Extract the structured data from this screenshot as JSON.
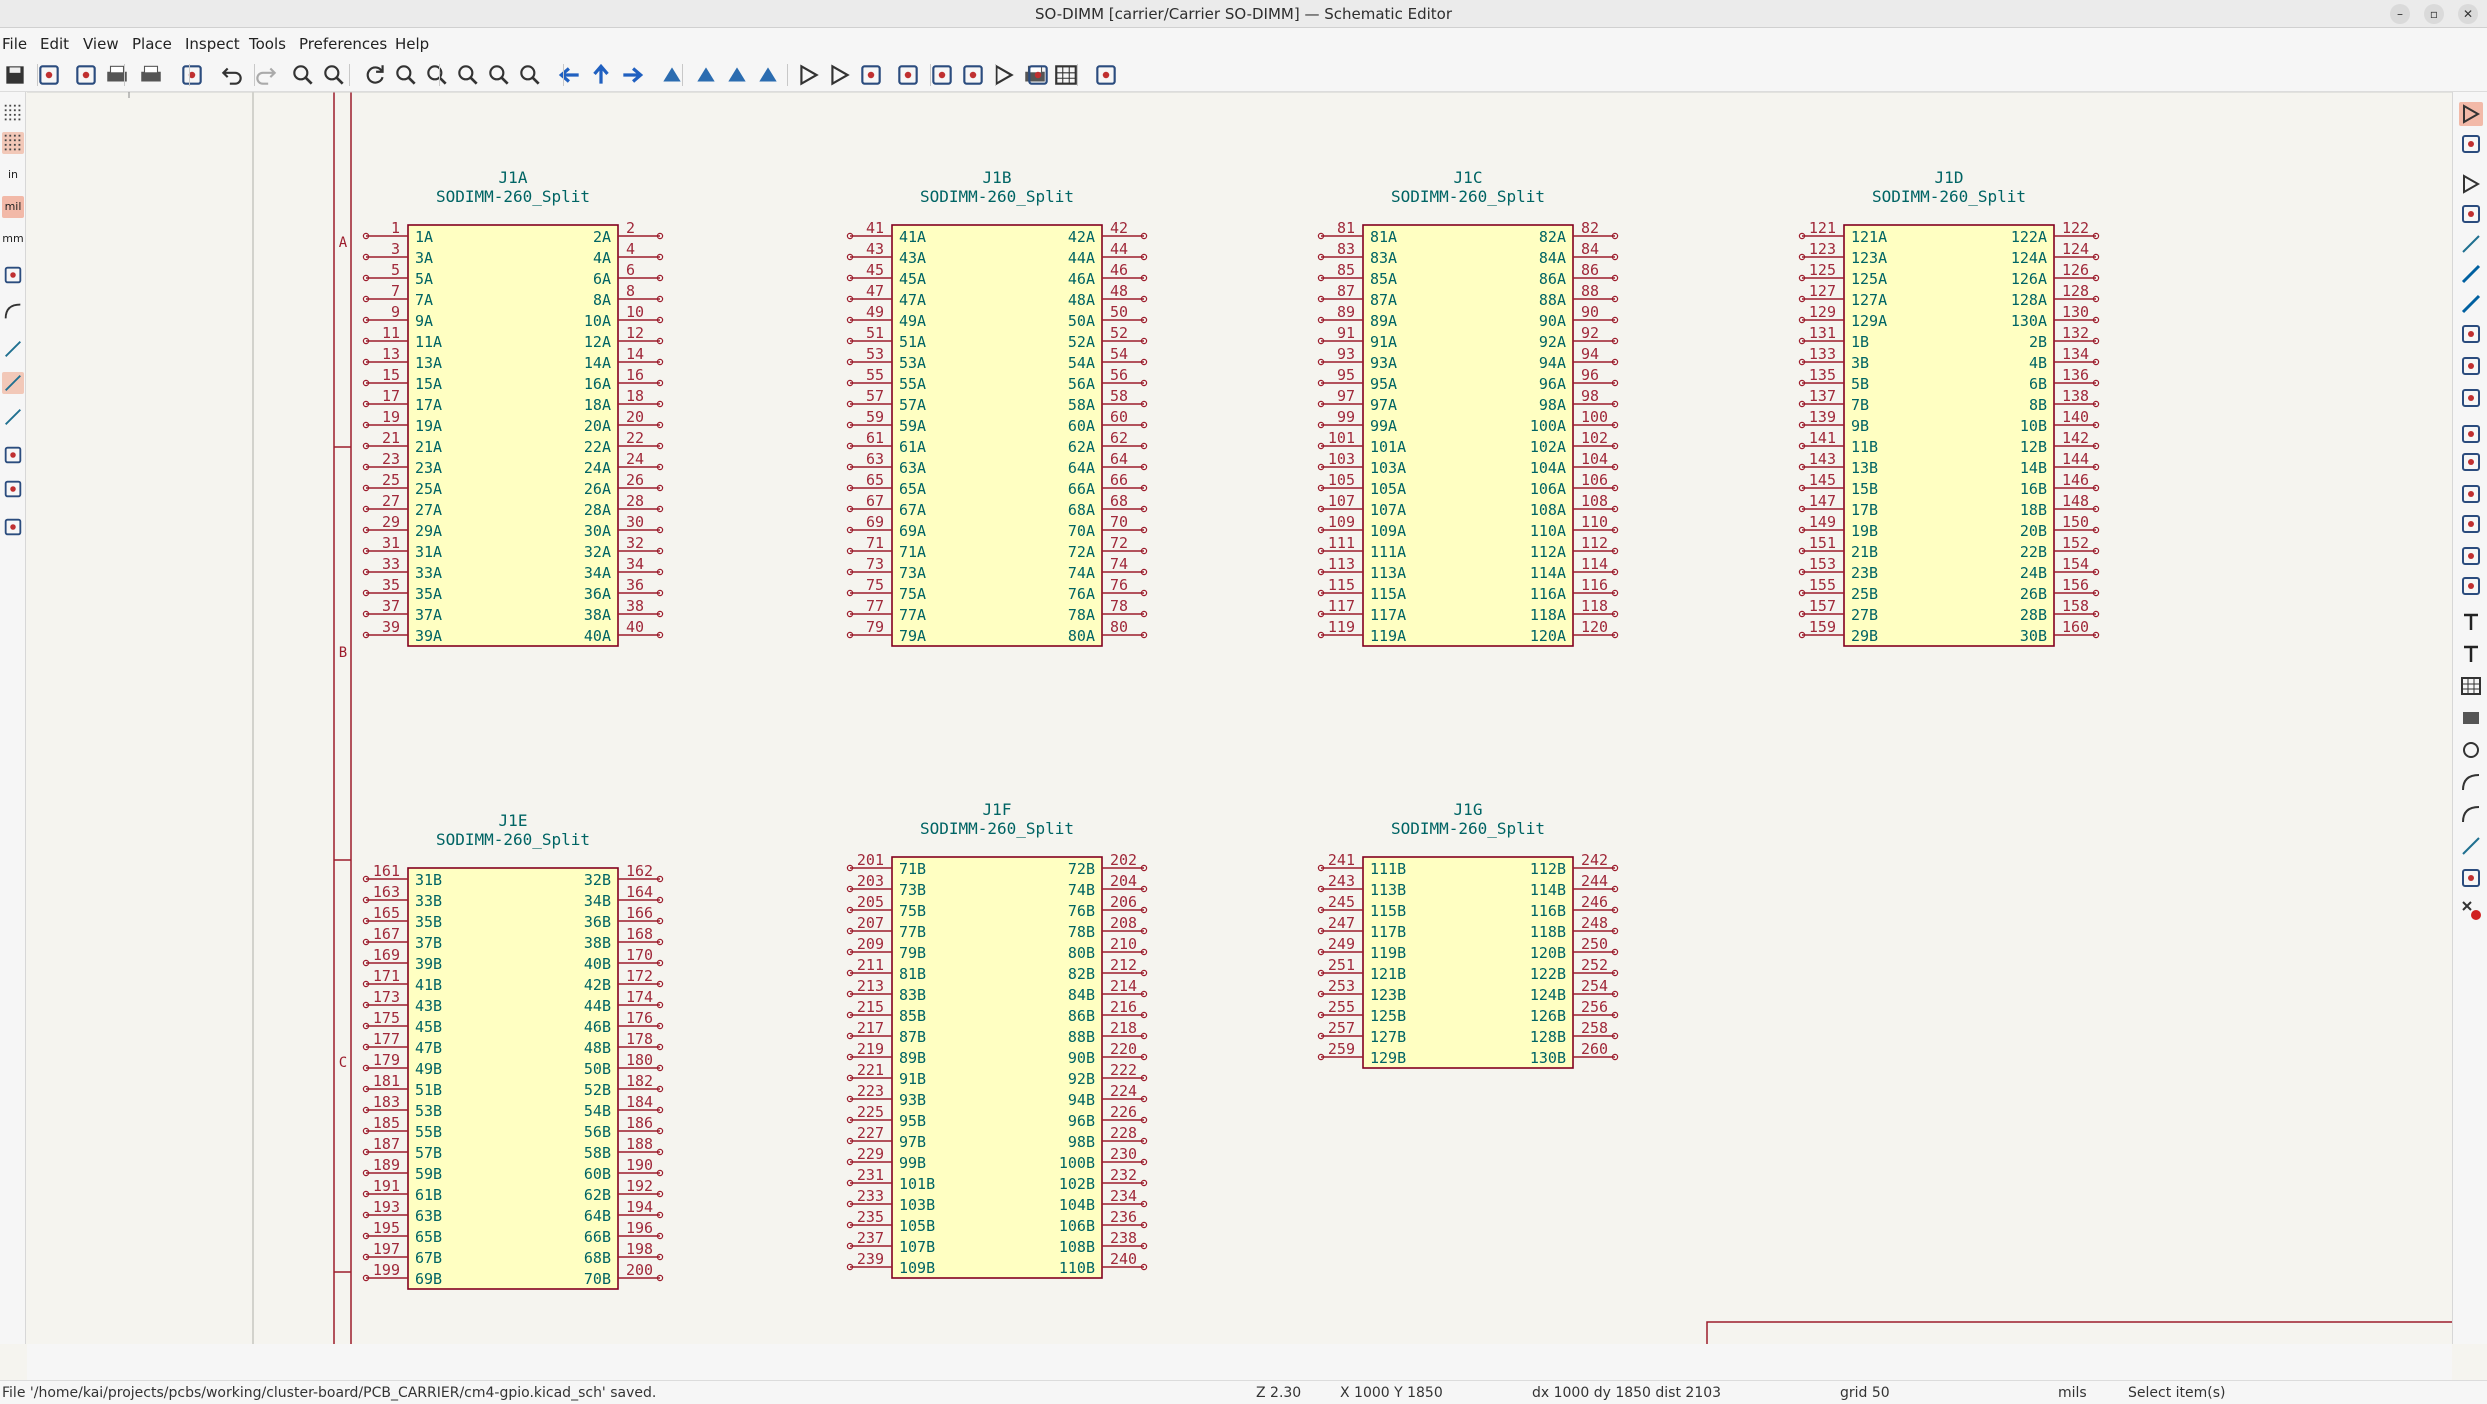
{
  "window": {
    "title": "SO-DIMM [carrier/Carrier SO-DIMM] — Schematic Editor"
  },
  "menu": [
    "File",
    "Edit",
    "View",
    "Place",
    "Inspect",
    "Tools",
    "Preferences",
    "Help"
  ],
  "toolbar_icons": [
    "save-icon",
    "schematic-setup-icon",
    "page-settings-icon",
    "print-icon",
    "plot-icon",
    "paste-icon",
    "undo-icon",
    "redo-icon",
    "find-icon",
    "find-replace-icon",
    "refresh-icon",
    "zoom-in-icon",
    "zoom-out-icon",
    "zoom-fit-icon",
    "zoom-objects-icon",
    "zoom-selection-icon",
    "navigate-back-icon",
    "navigate-up-icon",
    "navigate-forward-icon",
    "rotate-ccw-icon",
    "rotate-cw-icon",
    "mirror-vertical-icon",
    "mirror-horizontal-icon",
    "symbol-editor-icon",
    "symbol-browser-icon",
    "annotate-icon",
    "erc-icon",
    "bom-icon",
    "netlist-icon",
    "symbol-fields-icon",
    "footprint-assign-icon",
    "edit-table-icon",
    "update-pcb-icon",
    "pcb-editor-icon"
  ],
  "left_toolbar_icons": [
    "grid-icon",
    "grid-overrides-icon",
    "units-in-icon",
    "units-mil-icon",
    "units-mm-icon",
    "cursor-icon",
    "hierarchy-icon",
    "line-mode-free-icon",
    "line-mode-90-icon",
    "line-mode-45-icon",
    "annotations-icon",
    "properties-icon",
    "exclude-icon"
  ],
  "left_toolbar_labels": {
    "in": "in",
    "mil": "mil",
    "mm": "mm"
  },
  "right_toolbar_icons": [
    "select-icon",
    "highlight-net-icon",
    "add-symbol-icon",
    "add-power-icon",
    "add-wire-icon",
    "add-bus-icon",
    "wire-to-bus-icon",
    "no-connect-icon",
    "add-junction-icon",
    "add-label-icon",
    "add-netclass-icon",
    "add-global-label-icon",
    "add-hier-label-icon",
    "add-sheet-icon",
    "import-sheet-pin-icon",
    "add-sheet-pin-icon",
    "add-text-icon",
    "add-textbox-icon",
    "add-table-icon",
    "add-rectangle-icon",
    "add-circle-icon",
    "add-arc-icon",
    "add-bezier-icon",
    "add-line-icon",
    "add-image-icon",
    "delete-icon"
  ],
  "border": {
    "zone_labels": [
      "A",
      "B",
      "C"
    ]
  },
  "symbols": [
    {
      "ref": "J1A",
      "value": "SODIMM-260_Split",
      "left_pins": [
        "1",
        "3",
        "5",
        "7",
        "9",
        "11",
        "13",
        "15",
        "17",
        "19",
        "21",
        "23",
        "25",
        "27",
        "29",
        "31",
        "33",
        "35",
        "37",
        "39"
      ],
      "left_names": [
        "1A",
        "3A",
        "5A",
        "7A",
        "9A",
        "11A",
        "13A",
        "15A",
        "17A",
        "19A",
        "21A",
        "23A",
        "25A",
        "27A",
        "29A",
        "31A",
        "33A",
        "35A",
        "37A",
        "39A"
      ],
      "right_pins": [
        "2",
        "4",
        "6",
        "8",
        "10",
        "12",
        "14",
        "16",
        "18",
        "20",
        "22",
        "24",
        "26",
        "28",
        "30",
        "32",
        "34",
        "36",
        "38",
        "40"
      ],
      "right_names": [
        "2A",
        "4A",
        "6A",
        "8A",
        "10A",
        "12A",
        "14A",
        "16A",
        "18A",
        "20A",
        "22A",
        "24A",
        "26A",
        "28A",
        "30A",
        "32A",
        "34A",
        "36A",
        "38A",
        "40A"
      ]
    },
    {
      "ref": "J1B",
      "value": "SODIMM-260_Split",
      "left_pins": [
        "41",
        "43",
        "45",
        "47",
        "49",
        "51",
        "53",
        "55",
        "57",
        "59",
        "61",
        "63",
        "65",
        "67",
        "69",
        "71",
        "73",
        "75",
        "77",
        "79"
      ],
      "left_names": [
        "41A",
        "43A",
        "45A",
        "47A",
        "49A",
        "51A",
        "53A",
        "55A",
        "57A",
        "59A",
        "61A",
        "63A",
        "65A",
        "67A",
        "69A",
        "71A",
        "73A",
        "75A",
        "77A",
        "79A"
      ],
      "right_pins": [
        "42",
        "44",
        "46",
        "48",
        "50",
        "52",
        "54",
        "56",
        "58",
        "60",
        "62",
        "64",
        "66",
        "68",
        "70",
        "72",
        "74",
        "76",
        "78",
        "80"
      ],
      "right_names": [
        "42A",
        "44A",
        "46A",
        "48A",
        "50A",
        "52A",
        "54A",
        "56A",
        "58A",
        "60A",
        "62A",
        "64A",
        "66A",
        "68A",
        "70A",
        "72A",
        "74A",
        "76A",
        "78A",
        "80A"
      ]
    },
    {
      "ref": "J1C",
      "value": "SODIMM-260_Split",
      "left_pins": [
        "81",
        "83",
        "85",
        "87",
        "89",
        "91",
        "93",
        "95",
        "97",
        "99",
        "101",
        "103",
        "105",
        "107",
        "109",
        "111",
        "113",
        "115",
        "117",
        "119"
      ],
      "left_names": [
        "81A",
        "83A",
        "85A",
        "87A",
        "89A",
        "91A",
        "93A",
        "95A",
        "97A",
        "99A",
        "101A",
        "103A",
        "105A",
        "107A",
        "109A",
        "111A",
        "113A",
        "115A",
        "117A",
        "119A"
      ],
      "right_pins": [
        "82",
        "84",
        "86",
        "88",
        "90",
        "92",
        "94",
        "96",
        "98",
        "100",
        "102",
        "104",
        "106",
        "108",
        "110",
        "112",
        "114",
        "116",
        "118",
        "120"
      ],
      "right_names": [
        "82A",
        "84A",
        "86A",
        "88A",
        "90A",
        "92A",
        "94A",
        "96A",
        "98A",
        "100A",
        "102A",
        "104A",
        "106A",
        "108A",
        "110A",
        "112A",
        "114A",
        "116A",
        "118A",
        "120A"
      ]
    },
    {
      "ref": "J1D",
      "value": "SODIMM-260_Split",
      "left_pins": [
        "121",
        "123",
        "125",
        "127",
        "129",
        "131",
        "133",
        "135",
        "137",
        "139",
        "141",
        "143",
        "145",
        "147",
        "149",
        "151",
        "153",
        "155",
        "157",
        "159"
      ],
      "left_names": [
        "121A",
        "123A",
        "125A",
        "127A",
        "129A",
        "1B",
        "3B",
        "5B",
        "7B",
        "9B",
        "11B",
        "13B",
        "15B",
        "17B",
        "19B",
        "21B",
        "23B",
        "25B",
        "27B",
        "29B"
      ],
      "right_pins": [
        "122",
        "124",
        "126",
        "128",
        "130",
        "132",
        "134",
        "136",
        "138",
        "140",
        "142",
        "144",
        "146",
        "148",
        "150",
        "152",
        "154",
        "156",
        "158",
        "160"
      ],
      "right_names": [
        "122A",
        "124A",
        "126A",
        "128A",
        "130A",
        "2B",
        "4B",
        "6B",
        "8B",
        "10B",
        "12B",
        "14B",
        "16B",
        "18B",
        "20B",
        "22B",
        "24B",
        "26B",
        "28B",
        "30B"
      ]
    },
    {
      "ref": "J1E",
      "value": "SODIMM-260_Split",
      "left_pins": [
        "161",
        "163",
        "165",
        "167",
        "169",
        "171",
        "173",
        "175",
        "177",
        "179",
        "181",
        "183",
        "185",
        "187",
        "189",
        "191",
        "193",
        "195",
        "197",
        "199"
      ],
      "left_names": [
        "31B",
        "33B",
        "35B",
        "37B",
        "39B",
        "41B",
        "43B",
        "45B",
        "47B",
        "49B",
        "51B",
        "53B",
        "55B",
        "57B",
        "59B",
        "61B",
        "63B",
        "65B",
        "67B",
        "69B"
      ],
      "right_pins": [
        "162",
        "164",
        "166",
        "168",
        "170",
        "172",
        "174",
        "176",
        "178",
        "180",
        "182",
        "184",
        "186",
        "188",
        "190",
        "192",
        "194",
        "196",
        "198",
        "200"
      ],
      "right_names": [
        "32B",
        "34B",
        "36B",
        "38B",
        "40B",
        "42B",
        "44B",
        "46B",
        "48B",
        "50B",
        "52B",
        "54B",
        "56B",
        "58B",
        "60B",
        "62B",
        "64B",
        "66B",
        "68B",
        "70B"
      ]
    },
    {
      "ref": "J1F",
      "value": "SODIMM-260_Split",
      "left_pins": [
        "201",
        "203",
        "205",
        "207",
        "209",
        "211",
        "213",
        "215",
        "217",
        "219",
        "221",
        "223",
        "225",
        "227",
        "229",
        "231",
        "233",
        "235",
        "237",
        "239"
      ],
      "left_names": [
        "71B",
        "73B",
        "75B",
        "77B",
        "79B",
        "81B",
        "83B",
        "85B",
        "87B",
        "89B",
        "91B",
        "93B",
        "95B",
        "97B",
        "99B",
        "101B",
        "103B",
        "105B",
        "107B",
        "109B"
      ],
      "right_pins": [
        "202",
        "204",
        "206",
        "208",
        "210",
        "212",
        "214",
        "216",
        "218",
        "220",
        "222",
        "224",
        "226",
        "228",
        "230",
        "232",
        "234",
        "236",
        "238",
        "240"
      ],
      "right_names": [
        "72B",
        "74B",
        "76B",
        "78B",
        "80B",
        "82B",
        "84B",
        "86B",
        "88B",
        "90B",
        "92B",
        "94B",
        "96B",
        "98B",
        "100B",
        "102B",
        "104B",
        "106B",
        "108B",
        "110B"
      ]
    },
    {
      "ref": "J1G",
      "value": "SODIMM-260_Split",
      "left_pins": [
        "241",
        "243",
        "245",
        "247",
        "249",
        "251",
        "253",
        "255",
        "257",
        "259"
      ],
      "left_names": [
        "111B",
        "113B",
        "115B",
        "117B",
        "119B",
        "121B",
        "123B",
        "125B",
        "127B",
        "129B"
      ],
      "right_pins": [
        "242",
        "244",
        "246",
        "248",
        "250",
        "252",
        "254",
        "256",
        "258",
        "260"
      ],
      "right_names": [
        "112B",
        "114B",
        "116B",
        "118B",
        "120B",
        "122B",
        "124B",
        "126B",
        "128B",
        "130B"
      ]
    }
  ],
  "status": {
    "message": "File '/home/kai/projects/pcbs/working/cluster-board/PCB_CARRIER/cm4-gpio.kicad_sch' saved.",
    "zoom": "Z 2.30",
    "xy": "X 1000  Y 1850",
    "delta": "dx 1000  dy 1850  dist 2103",
    "grid": "grid 50",
    "units": "mils",
    "mode": "Select item(s)"
  },
  "colors": {
    "symbol_fill": "#ffffc2",
    "symbol_outline": "#84001f",
    "pin_color": "#9c1c2c",
    "pin_text": "#a0293a",
    "field_text": "#006464",
    "sheet_border": "#9c1c2c",
    "background": "#f5f4ef"
  }
}
